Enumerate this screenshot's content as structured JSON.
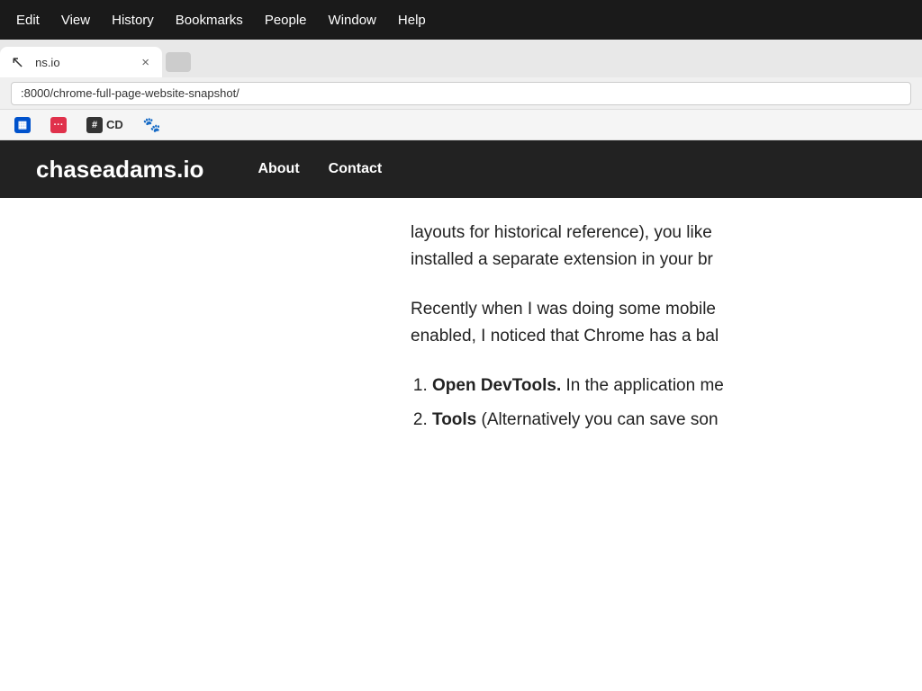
{
  "menubar": {
    "items": [
      "Edit",
      "View",
      "History",
      "Bookmarks",
      "People",
      "Window",
      "Help"
    ]
  },
  "tab": {
    "title": "ns.io",
    "close_label": "×"
  },
  "address": {
    "url": ":8000/chrome-full-page-website-snapshot/"
  },
  "bookmarks": [
    {
      "id": "trello",
      "type": "trello",
      "label": ""
    },
    {
      "id": "dots",
      "type": "dots",
      "label": ""
    },
    {
      "id": "hash-cd",
      "type": "hash-cd",
      "label": "CD"
    },
    {
      "id": "paw",
      "type": "paw",
      "label": ""
    }
  ],
  "site": {
    "logo": "chaseadams.io",
    "nav": [
      "About",
      "Contact"
    ]
  },
  "article": {
    "paragraph1": "layouts for historical reference), you like",
    "paragraph1_cont": "installed a separate extension in your br",
    "paragraph2": "Recently when I was doing some mobile",
    "paragraph2_cont": "enabled, I noticed that Chrome has a bal",
    "list_item1_bold": "Open DevTools.",
    "list_item1_text": " In the application me",
    "list_item2_bold": "Tools",
    "list_item2_text": " (Alternatively you can save son"
  }
}
